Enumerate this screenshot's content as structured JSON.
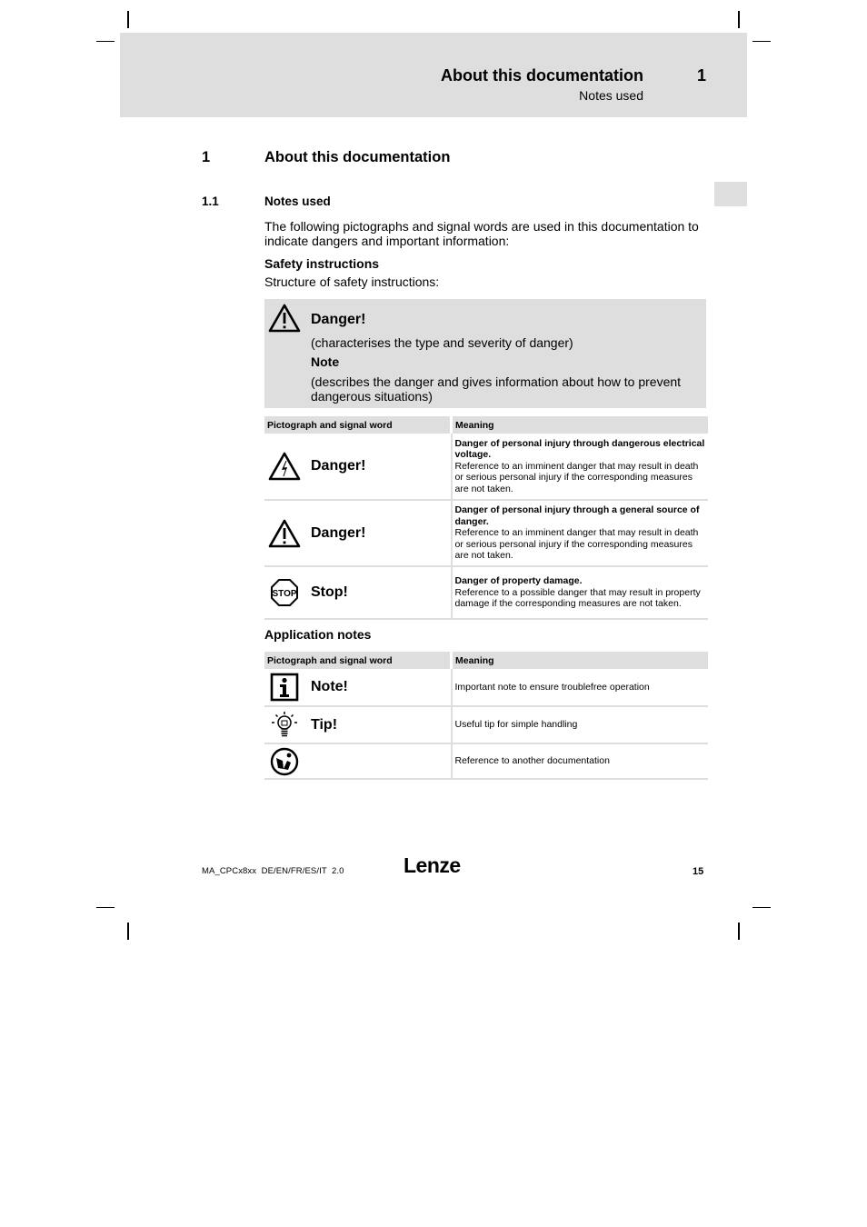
{
  "header": {
    "chapter_title": "About this documentation",
    "chapter_number": "1",
    "section_subtitle": "Notes used"
  },
  "heading1": {
    "number": "1",
    "title": "About this documentation"
  },
  "heading2": {
    "number": "1.1",
    "title": "Notes used"
  },
  "intro_text": "The following pictographs and signal words are used in this documentation to indicate dangers and important information:",
  "safety_section": {
    "title": "Safety instructions",
    "subtitle": "Structure of safety instructions:",
    "example_box": {
      "icon": "warning-triangle-icon",
      "signal_word": "Danger!",
      "line1": "(characterises the type and severity of danger)",
      "note_label": "Note",
      "line2": "(describes the danger and gives information about how to prevent dangerous situations)"
    },
    "table": {
      "headers": [
        "Pictograph and signal word",
        "Meaning"
      ],
      "rows": [
        {
          "icon": "electrical-danger-icon",
          "signal_word": "Danger!",
          "meaning_title": "Danger of personal injury through dangerous electrical voltage.",
          "meaning_text": "Reference to an imminent danger that may result in death or serious personal injury if the corresponding measures are not taken."
        },
        {
          "icon": "general-danger-icon",
          "signal_word": "Danger!",
          "meaning_title": "Danger of personal injury through a general source of danger.",
          "meaning_text": "Reference to an imminent danger that may result in death or serious personal injury if the corresponding measures are not taken."
        },
        {
          "icon": "stop-sign-icon",
          "signal_word": "Stop!",
          "icon_text": "STOP",
          "meaning_title": "Danger of property damage.",
          "meaning_text": "Reference to a possible danger that may result in property damage if the corresponding measures are not taken."
        }
      ]
    }
  },
  "application_section": {
    "title": "Application notes",
    "table": {
      "headers": [
        "Pictograph and signal word",
        "Meaning"
      ],
      "rows": [
        {
          "icon": "info-icon",
          "signal_word": "Note!",
          "meaning": "Important note to ensure troublefree operation"
        },
        {
          "icon": "lightbulb-icon",
          "signal_word": "Tip!",
          "meaning": "Useful tip for simple handling"
        },
        {
          "icon": "documentation-reference-icon",
          "signal_word": "",
          "meaning": "Reference to another documentation"
        }
      ]
    }
  },
  "footer": {
    "doc_id": "MA_CPCx8xx  DE/EN/FR/ES/IT  2.0",
    "logo": "Lenze",
    "page_number": "15"
  }
}
